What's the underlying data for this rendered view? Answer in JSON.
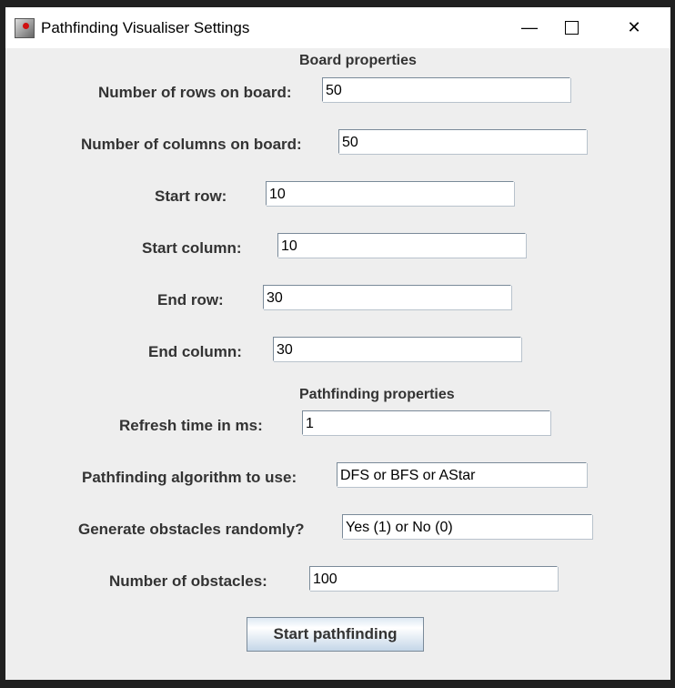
{
  "window": {
    "title": "Pathfinding Visualiser Settings"
  },
  "sections": {
    "board": "Board properties",
    "pathfinding": "Pathfinding properties"
  },
  "fields": [
    {
      "label": "Number of rows on board:",
      "value": "50"
    },
    {
      "label": "Number of columns on board:",
      "value": "50"
    },
    {
      "label": "Start row:",
      "value": "10"
    },
    {
      "label": "Start column:",
      "value": "10"
    },
    {
      "label": "End row:",
      "value": "30"
    },
    {
      "label": "End column:",
      "value": "30"
    },
    {
      "label": "Refresh time in ms:",
      "value": "1"
    },
    {
      "label": "Pathfinding algorithm to use:",
      "value": "DFS or BFS or AStar"
    },
    {
      "label": "Generate obstacles randomly?",
      "value": "Yes (1) or No (0)"
    },
    {
      "label": "Number of obstacles:",
      "value": "100"
    }
  ],
  "start_button": "Start pathfinding"
}
